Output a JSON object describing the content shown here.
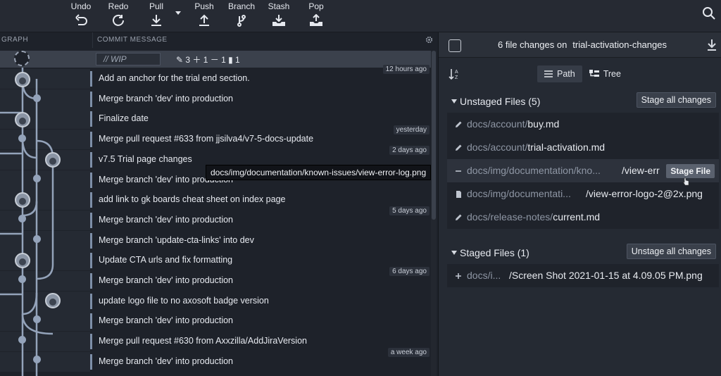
{
  "toolbar": {
    "undo": "Undo",
    "redo": "Redo",
    "pull": "Pull",
    "push": "Push",
    "branch": "Branch",
    "stash": "Stash",
    "pop": "Pop"
  },
  "graph": {
    "col_graph": "GRAPH",
    "col_message": "COMMIT MESSAGE",
    "wip": {
      "label": "// WIP",
      "stats": "✎ 3  ＋ 1  － 1  ▮ 1"
    },
    "tooltip": "docs/img/documentation/known-issues/view-error-log.png",
    "commits": [
      {
        "message": "Add an anchor for the trial end section.",
        "date": "12 hours ago"
      },
      {
        "message": "Merge branch 'dev' into production",
        "date": ""
      },
      {
        "message": "Finalize date",
        "date": ""
      },
      {
        "message": "Merge pull request #633 from jjsilva4/v7-5-docs-update",
        "date": "yesterday"
      },
      {
        "message": "v7.5 Trial page changes",
        "date": "2 days ago"
      },
      {
        "message": "Merge branch 'dev' into production",
        "date": ""
      },
      {
        "message": "add link to gk boards cheat sheet on index page",
        "date": ""
      },
      {
        "message": "Merge branch 'dev' into production",
        "date": "5 days ago"
      },
      {
        "message": "Merge branch 'update-cta-links' into dev",
        "date": ""
      },
      {
        "message": "Update CTA urls and fix formatting",
        "date": ""
      },
      {
        "message": "Merge branch 'dev' into production",
        "date": "6 days ago"
      },
      {
        "message": "update logo file to no axosoft badge version",
        "date": ""
      },
      {
        "message": "Merge branch 'dev' into production",
        "date": ""
      },
      {
        "message": "Merge pull request #630 from Axxzilla/AddJiraVersion",
        "date": ""
      },
      {
        "message": "Merge branch 'dev' into production",
        "date": "a week ago"
      }
    ]
  },
  "changes": {
    "count_text": "6 file changes on",
    "branch": "trial-activation-changes",
    "view_path": "Path",
    "view_tree": "Tree",
    "unstaged_label": "Unstaged Files (5)",
    "stage_all": "Stage all changes",
    "unstaged": [
      {
        "icon": "pencil-icon",
        "path": "docs/account/",
        "name": "buy.md"
      },
      {
        "icon": "pencil-icon",
        "path": "docs/account/",
        "name": "trial-activation.md"
      },
      {
        "icon": "minus-icon",
        "path": "docs/img/documentation/kno...",
        "name": "/view-err"
      },
      {
        "icon": "file-icon",
        "path": "docs/img/documentati...",
        "name": "/view-error-logo-2@2x.png"
      },
      {
        "icon": "pencil-icon",
        "path": "docs/release-notes/",
        "name": "current.md"
      }
    ],
    "stage_file": "Stage File",
    "staged_label": "Staged Files (1)",
    "unstage_all": "Unstage all changes",
    "staged": [
      {
        "icon": "plus-icon",
        "path": "docs/i...",
        "name": "/Screen Shot 2021-01-15 at 4.09.05 PM.png"
      }
    ]
  }
}
